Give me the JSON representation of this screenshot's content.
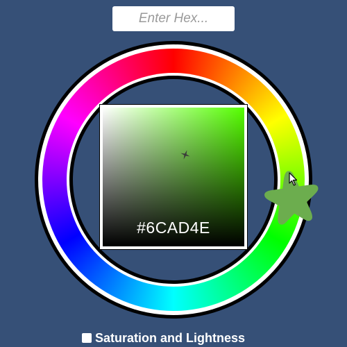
{
  "hex_input": {
    "placeholder": "Enter Hex...",
    "value": ""
  },
  "color_picker": {
    "selected_hex_label": "#6CAD4E",
    "selected_color": "#6CAD4E",
    "hue_color": "#55FF00"
  },
  "saturation_toggle": {
    "label": "Saturation and Lightness",
    "checked": false
  },
  "colors": {
    "background": "#365077",
    "handle": "#6CAD4E"
  },
  "icons": {
    "hue_handle": "star-icon",
    "sv_marker": "crosshair-icon",
    "pointer": "mouse-pointer-icon"
  }
}
